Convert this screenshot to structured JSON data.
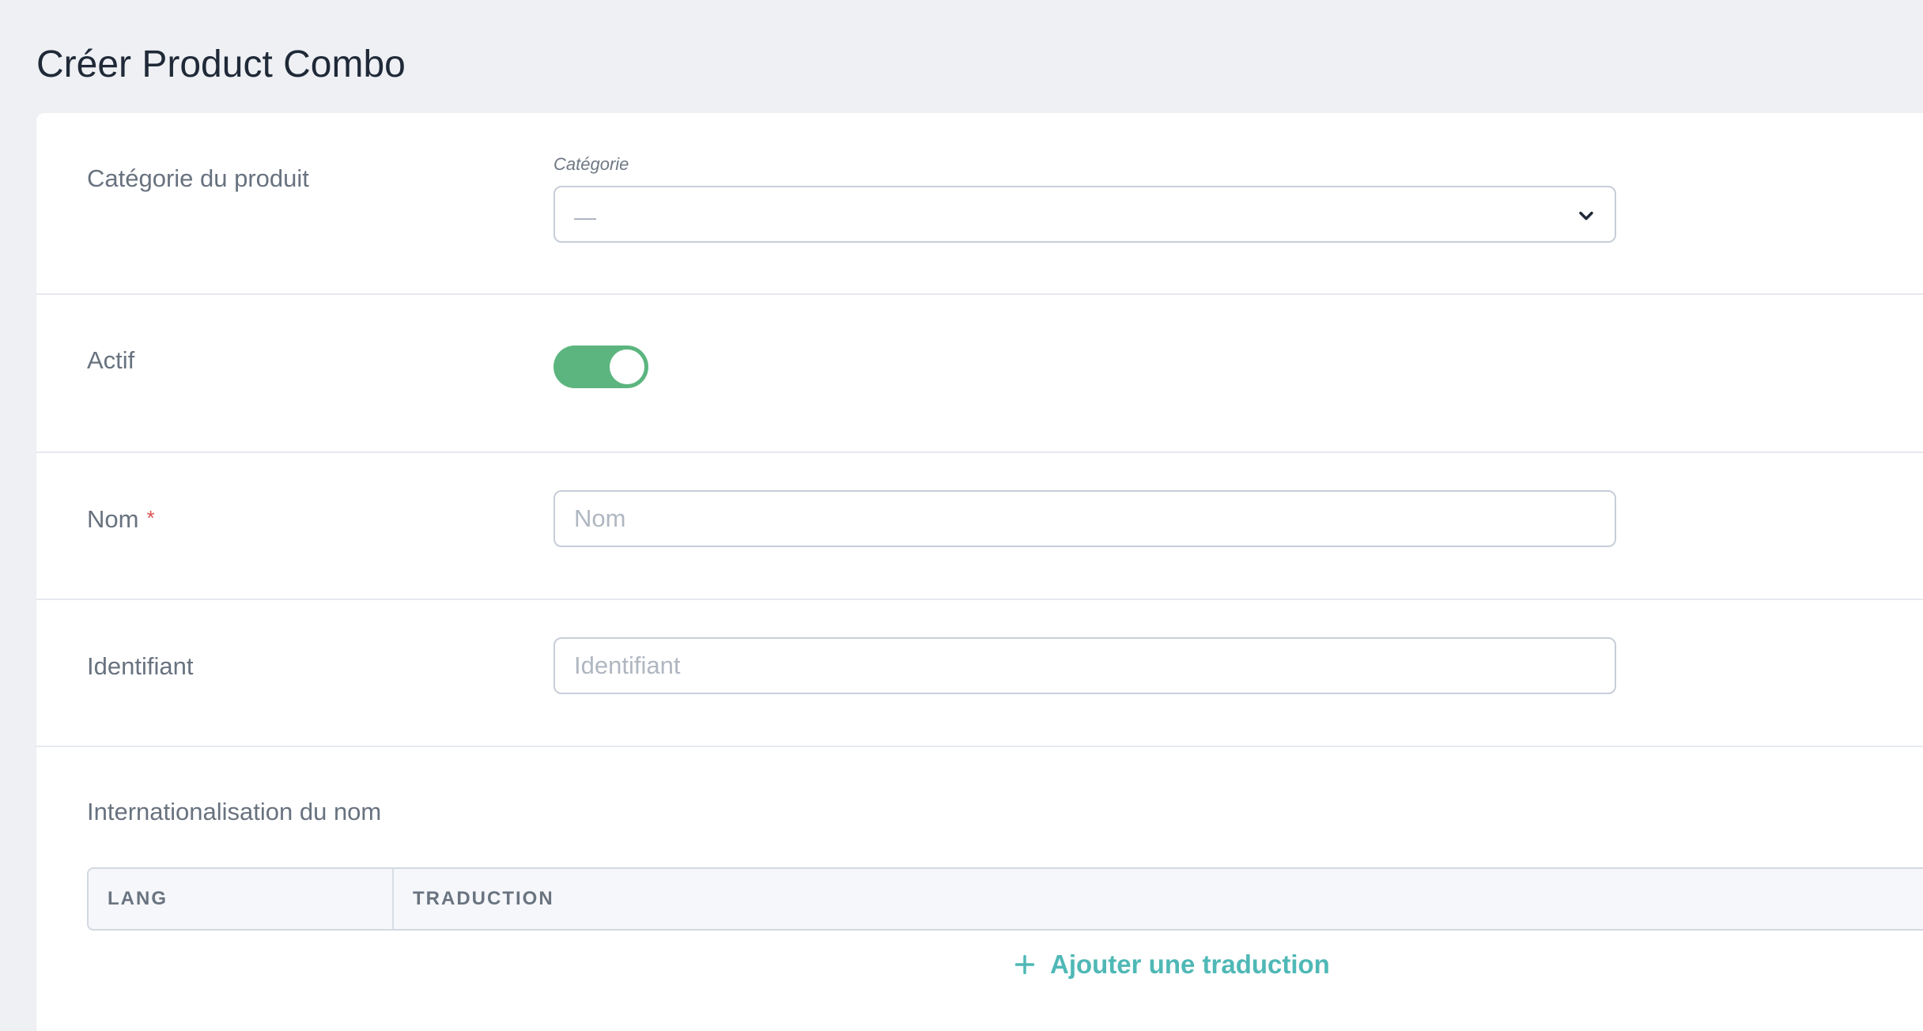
{
  "page": {
    "title": "Créer Product Combo"
  },
  "form": {
    "category": {
      "label": "Catégorie du produit",
      "caption": "Catégorie",
      "selected_value": "—"
    },
    "active": {
      "label": "Actif",
      "checked": true,
      "on_color": "#5cb57f"
    },
    "name": {
      "label": "Nom",
      "required_mark": "*",
      "placeholder": "Nom",
      "value": ""
    },
    "identifier": {
      "label": "Identifiant",
      "placeholder": "Identifiant",
      "value": ""
    },
    "i18n": {
      "title": "Internationalisation du nom",
      "columns": [
        "Lang",
        "Traduction"
      ],
      "add_label": "Ajouter une traduction",
      "accent_color": "#4fb8b6"
    }
  },
  "icons": {
    "select_chevron": "chevron-down-icon",
    "add": "plus-icon"
  }
}
